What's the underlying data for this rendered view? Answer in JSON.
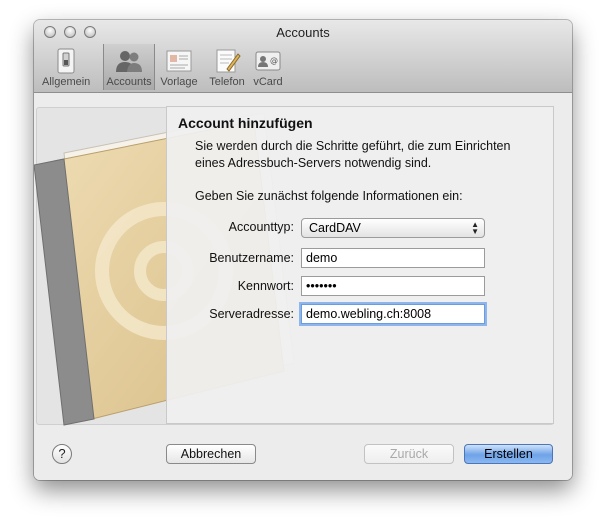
{
  "window": {
    "title": "Accounts"
  },
  "toolbar": {
    "items": [
      {
        "label": "Allgemein",
        "icon": "switch-icon"
      },
      {
        "label": "Accounts",
        "icon": "accounts-icon",
        "selected": true
      },
      {
        "label": "Vorlage",
        "icon": "template-icon"
      },
      {
        "label": "Telefon",
        "icon": "telephone-icon"
      },
      {
        "label": "vCard",
        "icon": "vcard-icon"
      }
    ]
  },
  "sheet": {
    "title": "Account hinzufügen",
    "intro_line1": "Sie werden durch die Schritte geführt, die zum Einrichten",
    "intro_line2": "eines Adressbuch-Servers notwendig sind.",
    "prompt": "Geben Sie zunächst folgende Informationen ein:",
    "account_type": {
      "label": "Accounttyp:",
      "value": "CardDAV"
    },
    "username": {
      "label": "Benutzername:",
      "value": "demo"
    },
    "password": {
      "label": "Kennwort:",
      "value": "•••••••"
    },
    "server": {
      "label": "Serveradresse:",
      "value": "demo.webling.ch:8008"
    }
  },
  "buttons": {
    "help": "?",
    "cancel": "Abbrechen",
    "back": "Zurück",
    "create": "Erstellen"
  },
  "colors": {
    "accent": "#6fa2e8",
    "book_cover": "#e4cd9b",
    "spine": "#8c8c8c"
  }
}
